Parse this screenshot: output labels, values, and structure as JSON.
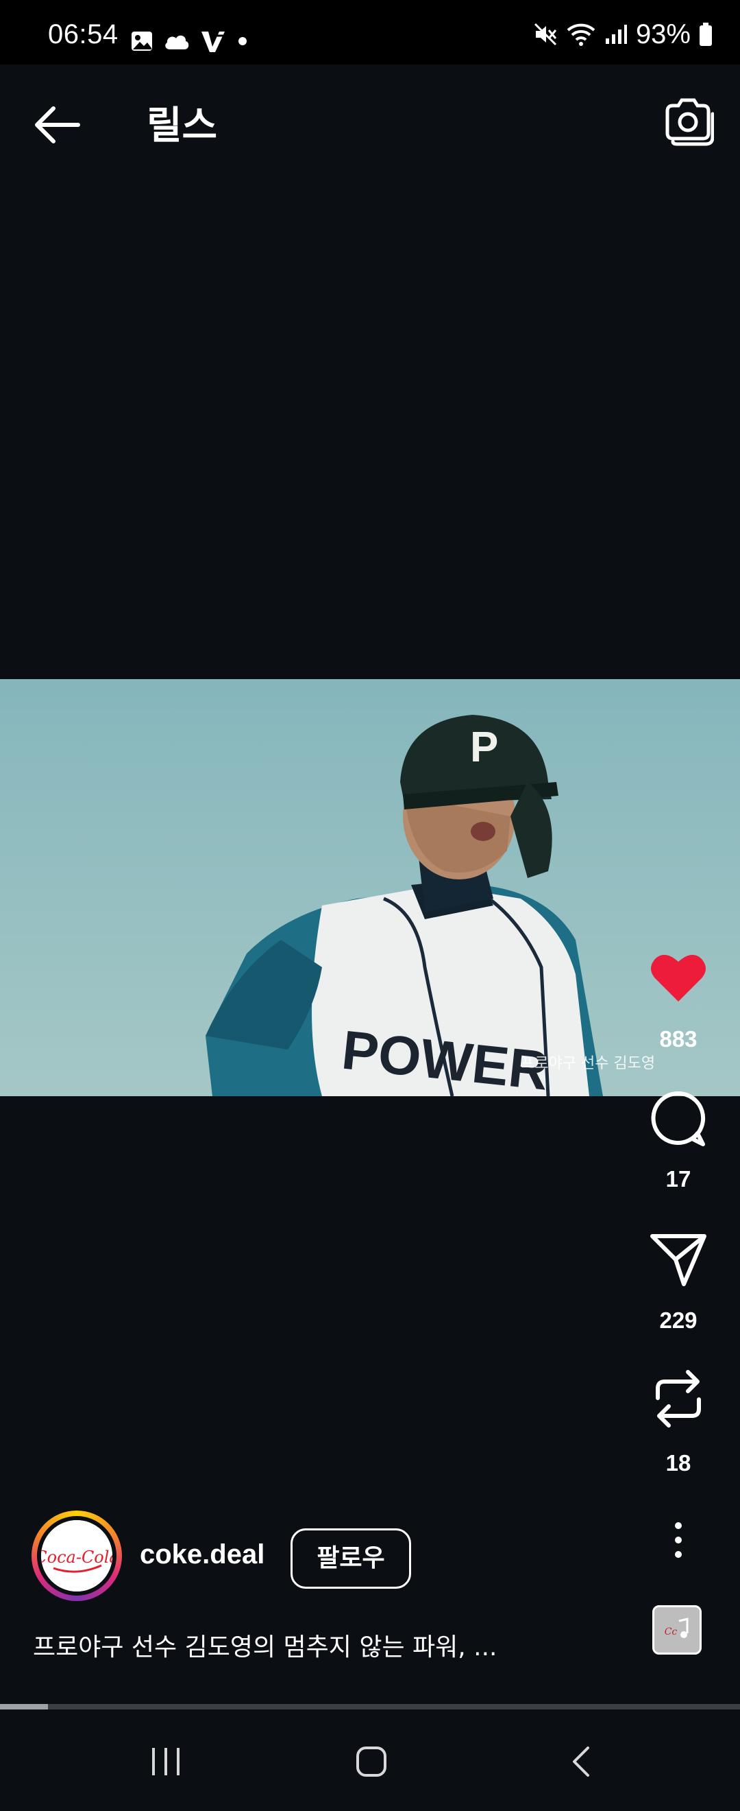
{
  "status_bar": {
    "time": "06:54",
    "battery": "93%",
    "left_icons": [
      "gallery-icon",
      "cloud-icon",
      "v-app-icon",
      "dot-icon"
    ],
    "right_icons": [
      "mute-icon",
      "wifi-icon",
      "signal-icon",
      "battery-icon"
    ]
  },
  "header": {
    "title": "릴스",
    "back_icon": "back-arrow-icon",
    "camera_icon": "camera-icon"
  },
  "video": {
    "watermark": "프로야구 선수 김도영",
    "helmet_letter": "P",
    "jersey_text": "POWER"
  },
  "actions": {
    "like_count": "883",
    "comment_count": "17",
    "share_count": "229",
    "repost_count": "18",
    "like_color": "#ed1c3a"
  },
  "profile": {
    "username": "coke.deal",
    "follow_label": "팔로우",
    "avatar_brand": "Coca-Cola"
  },
  "caption": "프로야구 선수 김도영의 멈추지 않는 파워, ...",
  "progress": {
    "value": 0.065
  },
  "nav": {
    "icons": [
      "recents-icon",
      "home-icon",
      "back-icon"
    ]
  }
}
